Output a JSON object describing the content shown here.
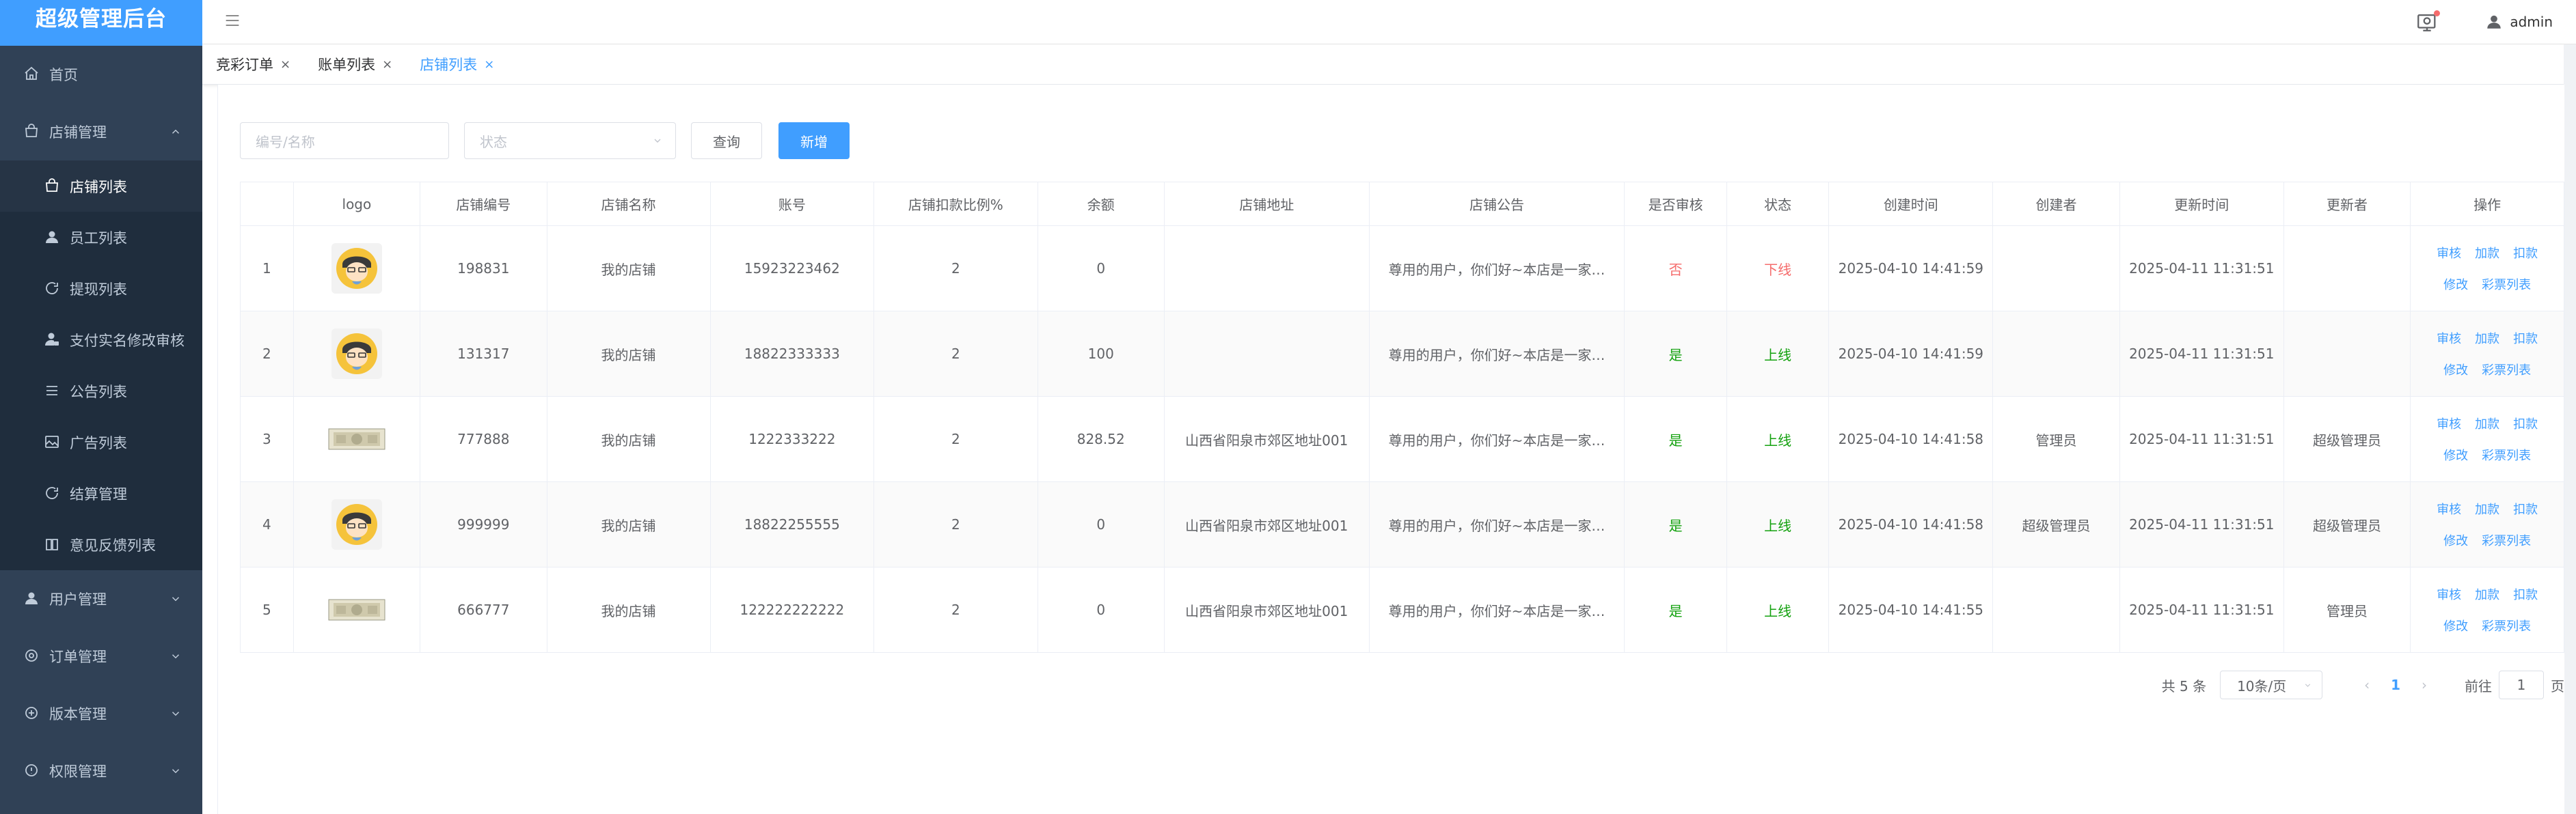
{
  "app": {
    "title": "超级管理后台"
  },
  "sidebar": {
    "items": [
      {
        "label": "首页",
        "icon": "home-icon"
      },
      {
        "label": "店铺管理",
        "icon": "shop-icon",
        "open": true,
        "children": [
          {
            "label": "店铺列表",
            "icon": "shop-icon",
            "active": true
          },
          {
            "label": "员工列表",
            "icon": "user-icon"
          },
          {
            "label": "提现列表",
            "icon": "refresh-icon"
          },
          {
            "label": "支付实名修改审核",
            "icon": "user-lock-icon"
          },
          {
            "label": "公告列表",
            "icon": "list-icon"
          },
          {
            "label": "广告列表",
            "icon": "image-icon"
          },
          {
            "label": "结算管理",
            "icon": "refresh-icon"
          },
          {
            "label": "意见反馈列表",
            "icon": "book-icon"
          }
        ]
      },
      {
        "label": "用户管理",
        "icon": "user-icon"
      },
      {
        "label": "订单管理",
        "icon": "circle-icon"
      },
      {
        "label": "版本管理",
        "icon": "plus-circle-icon"
      },
      {
        "label": "权限管理",
        "icon": "info-circle-icon"
      }
    ]
  },
  "header": {
    "username": "admin"
  },
  "tabs": [
    {
      "label": "竞彩订单",
      "active": false
    },
    {
      "label": "账单列表",
      "active": false
    },
    {
      "label": "店铺列表",
      "active": true
    }
  ],
  "filters": {
    "search_placeholder": "编号/名称",
    "status_placeholder": "状态",
    "query_label": "查询",
    "add_label": "新增"
  },
  "table": {
    "columns": [
      "",
      "logo",
      "店铺编号",
      "店铺名称",
      "账号",
      "店铺扣款比例%",
      "余额",
      "店铺地址",
      "店铺公告",
      "是否审核",
      "状态",
      "创建时间",
      "创建者",
      "更新时间",
      "更新者",
      "操作"
    ],
    "rows": [
      {
        "idx": "1",
        "logo": "avatar",
        "code": "198831",
        "name": "我的店铺",
        "account": "15923223462",
        "ratio": "2",
        "balance": "0",
        "address": "",
        "notice": "尊用的用户，你们好~本店是一家…",
        "audited": "否",
        "status": "下线",
        "created": "2025-04-10 14:41:59",
        "creator": "",
        "updated": "2025-04-11 11:31:51",
        "updater": ""
      },
      {
        "idx": "2",
        "logo": "avatar",
        "code": "131317",
        "name": "我的店铺",
        "account": "18822333333",
        "ratio": "2",
        "balance": "100",
        "address": "",
        "notice": "尊用的用户，你们好~本店是一家…",
        "audited": "是",
        "status": "上线",
        "created": "2025-04-10 14:41:59",
        "creator": "",
        "updated": "2025-04-11 11:31:51",
        "updater": ""
      },
      {
        "idx": "3",
        "logo": "banknote",
        "code": "777888",
        "name": "我的店铺",
        "account": "1222333222",
        "ratio": "2",
        "balance": "828.52",
        "address": "山西省阳泉市郊区地址001",
        "notice": "尊用的用户，你们好~本店是一家…",
        "audited": "是",
        "status": "上线",
        "created": "2025-04-10 14:41:58",
        "creator": "管理员",
        "updated": "2025-04-11 11:31:51",
        "updater": "超级管理员"
      },
      {
        "idx": "4",
        "logo": "avatar",
        "code": "999999",
        "name": "我的店铺",
        "account": "18822255555",
        "ratio": "2",
        "balance": "0",
        "address": "山西省阳泉市郊区地址001",
        "notice": "尊用的用户，你们好~本店是一家…",
        "audited": "是",
        "status": "上线",
        "created": "2025-04-10 14:41:58",
        "creator": "超级管理员",
        "updated": "2025-04-11 11:31:51",
        "updater": "超级管理员"
      },
      {
        "idx": "5",
        "logo": "banknote",
        "code": "666777",
        "name": "我的店铺",
        "account": "122222222222",
        "ratio": "2",
        "balance": "0",
        "address": "山西省阳泉市郊区地址001",
        "notice": "尊用的用户，你们好~本店是一家…",
        "audited": "是",
        "status": "上线",
        "created": "2025-04-10 14:41:55",
        "creator": "",
        "updated": "2025-04-11 11:31:51",
        "updater": "管理员"
      }
    ],
    "actions": {
      "audit": "审核",
      "add_money": "加款",
      "deduct": "扣款",
      "edit": "修改",
      "lottery_list": "彩票列表"
    }
  },
  "pagination": {
    "total": "共 5 条",
    "page_size": "10条/页",
    "current": "1",
    "goto_prefix": "前往",
    "goto_value": "1",
    "goto_suffix": "页"
  },
  "colors": {
    "sidebar_bg": "#304156",
    "brand_bg": "#409eff",
    "primary": "#409eff",
    "danger": "#f56c6c",
    "success": "#13a10e"
  }
}
